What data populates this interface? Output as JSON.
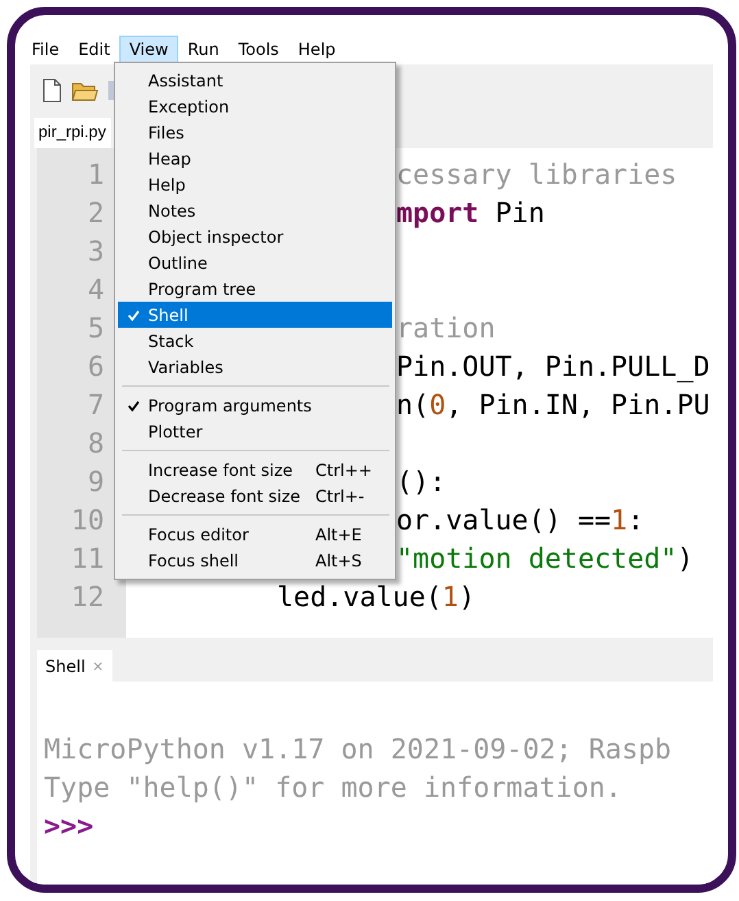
{
  "menu_bar": [
    {
      "label": "File",
      "selected": false
    },
    {
      "label": "Edit",
      "selected": false
    },
    {
      "label": "View",
      "selected": true
    },
    {
      "label": "Run",
      "selected": false
    },
    {
      "label": "Tools",
      "selected": false
    },
    {
      "label": "Help",
      "selected": false
    }
  ],
  "editor_tab": {
    "label": "pir_rpi.py"
  },
  "editor": {
    "line_numbers": [
      "1",
      "2",
      "3",
      "4",
      "5",
      "6",
      "7",
      "8",
      "9",
      "10",
      "11",
      "12"
    ],
    "lines": [
      {
        "kind": "clipped",
        "segments": [
          {
            "kind": "comment",
            "text": "cessary libraries"
          }
        ]
      },
      {
        "kind": "clipped",
        "segments": [
          {
            "kind": "keyword",
            "text": "mport"
          },
          {
            "kind": "plain",
            "text": " Pin"
          }
        ]
      },
      {
        "kind": "blank"
      },
      {
        "kind": "blank"
      },
      {
        "kind": "clipped",
        "segments": [
          {
            "kind": "comment",
            "text": "ration"
          }
        ]
      },
      {
        "kind": "clipped",
        "segments": [
          {
            "kind": "plain",
            "text": "Pin.OUT, Pin.PULL_D"
          }
        ]
      },
      {
        "kind": "clipped",
        "segments": [
          {
            "kind": "plain",
            "text": "n("
          },
          {
            "kind": "number",
            "text": "0"
          },
          {
            "kind": "plain",
            "text": ", Pin.IN, Pin.PU"
          }
        ]
      },
      {
        "kind": "blank"
      },
      {
        "kind": "clipped",
        "segments": [
          {
            "kind": "plain",
            "text": "():"
          }
        ]
      },
      {
        "kind": "clipped",
        "segments": [
          {
            "kind": "plain",
            "text": "or.value() =="
          },
          {
            "kind": "number",
            "text": "1"
          },
          {
            "kind": "plain",
            "text": ":"
          }
        ]
      },
      {
        "kind": "clipped",
        "segments": [
          {
            "kind": "string",
            "text": "\"motion detected\""
          },
          {
            "kind": "plain",
            "text": ")"
          }
        ]
      },
      {
        "kind": "indented",
        "segments": [
          {
            "kind": "plain",
            "text": "led.value("
          },
          {
            "kind": "number",
            "text": "1"
          },
          {
            "kind": "plain",
            "text": ")"
          }
        ]
      }
    ]
  },
  "view_menu": {
    "groups": [
      [
        {
          "label": "Assistant",
          "checked": false,
          "selected": false
        },
        {
          "label": "Exception",
          "checked": false,
          "selected": false
        },
        {
          "label": "Files",
          "checked": false,
          "selected": false
        },
        {
          "label": "Heap",
          "checked": false,
          "selected": false
        },
        {
          "label": "Help",
          "checked": false,
          "selected": false
        },
        {
          "label": "Notes",
          "checked": false,
          "selected": false
        },
        {
          "label": "Object inspector",
          "checked": false,
          "selected": false
        },
        {
          "label": "Outline",
          "checked": false,
          "selected": false
        },
        {
          "label": "Program tree",
          "checked": false,
          "selected": false
        },
        {
          "label": "Shell",
          "checked": true,
          "selected": true
        },
        {
          "label": "Stack",
          "checked": false,
          "selected": false
        },
        {
          "label": "Variables",
          "checked": false,
          "selected": false
        }
      ],
      [
        {
          "label": "Program arguments",
          "checked": true,
          "selected": false
        },
        {
          "label": "Plotter",
          "checked": false,
          "selected": false
        }
      ],
      [
        {
          "label": "Increase font size",
          "shortcut": "Ctrl++",
          "checked": false,
          "selected": false
        },
        {
          "label": "Decrease font size",
          "shortcut": "Ctrl+-",
          "checked": false,
          "selected": false
        }
      ],
      [
        {
          "label": "Focus editor",
          "shortcut": "Alt+E",
          "checked": false,
          "selected": false
        },
        {
          "label": "Focus shell",
          "shortcut": "Alt+S",
          "checked": false,
          "selected": false
        }
      ]
    ]
  },
  "shell_tab": {
    "label": "Shell",
    "close": "×"
  },
  "shell": {
    "output": [
      "MicroPython v1.17 on 2021-09-02; Raspb",
      "Type \"help()\" for more information."
    ],
    "prompt": ">>>"
  }
}
